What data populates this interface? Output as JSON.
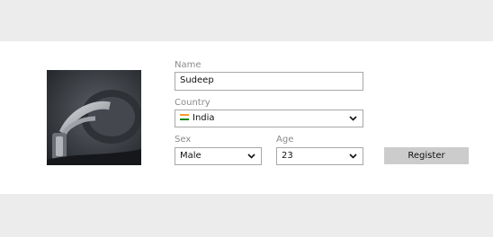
{
  "form": {
    "name": {
      "label": "Name",
      "value": "Sudeep"
    },
    "country": {
      "label": "Country",
      "value": "India",
      "flag_icon": "india-flag-icon"
    },
    "sex": {
      "label": "Sex",
      "value": "Male"
    },
    "age": {
      "label": "Age",
      "value": "23"
    },
    "register_label": "Register"
  },
  "colors": {
    "page_background": "#ececec",
    "panel_background": "#ffffff",
    "field_border": "#a8a8a8",
    "label_text": "#8a8a8a",
    "button_background": "#cccccc",
    "flag_saffron": "#ff9933",
    "flag_white": "#ffffff",
    "flag_green": "#138808"
  },
  "image": {
    "subject": "headphones-photo"
  }
}
